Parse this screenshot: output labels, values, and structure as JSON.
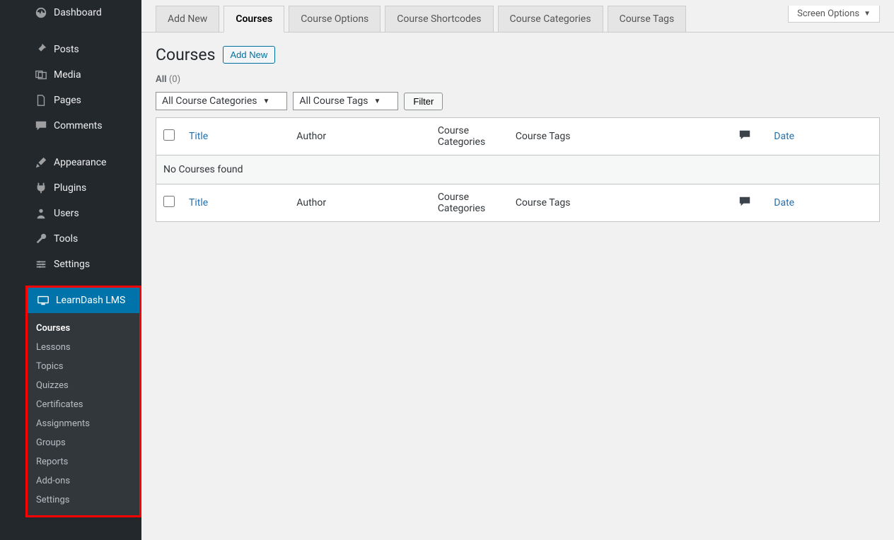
{
  "sidebar": {
    "items": [
      {
        "label": "Dashboard"
      },
      {
        "label": "Posts"
      },
      {
        "label": "Media"
      },
      {
        "label": "Pages"
      },
      {
        "label": "Comments"
      },
      {
        "label": "Appearance"
      },
      {
        "label": "Plugins"
      },
      {
        "label": "Users"
      },
      {
        "label": "Tools"
      },
      {
        "label": "Settings"
      }
    ],
    "learndash": {
      "label": "LearnDash LMS",
      "submenu": [
        {
          "label": "Courses"
        },
        {
          "label": "Lessons"
        },
        {
          "label": "Topics"
        },
        {
          "label": "Quizzes"
        },
        {
          "label": "Certificates"
        },
        {
          "label": "Assignments"
        },
        {
          "label": "Groups"
        },
        {
          "label": "Reports"
        },
        {
          "label": "Add-ons"
        },
        {
          "label": "Settings"
        }
      ]
    }
  },
  "screen_options_label": "Screen Options",
  "tabs": [
    {
      "label": "Add New"
    },
    {
      "label": "Courses"
    },
    {
      "label": "Course Options"
    },
    {
      "label": "Course Shortcodes"
    },
    {
      "label": "Course Categories"
    },
    {
      "label": "Course Tags"
    }
  ],
  "page_title": "Courses",
  "add_new_label": "Add New",
  "subsubsub_all_label": "All",
  "subsubsub_all_count": "(0)",
  "filters": {
    "category_label": "All Course Categories",
    "tag_label": "All Course Tags",
    "filter_button": "Filter"
  },
  "table": {
    "columns": {
      "title": "Title",
      "author": "Author",
      "categories": "Course Categories",
      "tags": "Course Tags",
      "date": "Date"
    },
    "empty_message": "No Courses found"
  }
}
